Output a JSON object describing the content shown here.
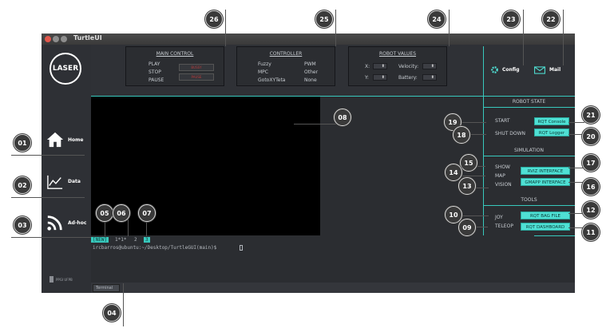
{
  "app": {
    "title": "TurtleUI"
  },
  "logo": {
    "text": "LASER"
  },
  "sidebar": {
    "items": [
      {
        "label": "Home",
        "icon": "home-icon"
      },
      {
        "label": "Data",
        "icon": "chart-icon"
      },
      {
        "label": "Ad-hoc",
        "icon": "wifi-icon"
      }
    ],
    "footer": "PPGI UFPB"
  },
  "main_control": {
    "title": "MAIN CONTROL",
    "play": "PLAY",
    "stop": "STOP",
    "pause": "PAUSE",
    "status_1": "BUSSY",
    "status_2": "PAUSE"
  },
  "controller": {
    "title": "CONTROLLER",
    "options": [
      "Fuzzy",
      "PWM",
      "MPC",
      "Other",
      "GotoXYTeta",
      "None"
    ]
  },
  "robot_values": {
    "title": "ROBOT VALUES",
    "x_label": "X:",
    "y_label": "Y:",
    "velocity_label": "Velocity:",
    "battery_label": "Battery:"
  },
  "top_right": {
    "config_label": "Config",
    "mail_label": "Mail"
  },
  "robot_state": {
    "title": "ROBOT STATE",
    "start": "START",
    "shutdown": "SHUT DOWN",
    "rqt_console": "RQT Console",
    "rqt_logger": "RQT Logger"
  },
  "simulation": {
    "title": "SIMULATION",
    "show": "SHOW",
    "map": "MAP",
    "vision": "VISION",
    "rviz": "RVIZ INTERFACE",
    "gmapp": "GMAPP INTERFACE"
  },
  "tools": {
    "title": "TOOLS",
    "joy": "JOY",
    "teleop": "TELEOP",
    "rqt_bag": "RQT BAG FILE",
    "rqt_dashboard": "RQT DASHBOARD"
  },
  "terminal": {
    "tabs": [
      "[NEW]",
      "1*1*",
      "2",
      "3"
    ],
    "prompt": "ircbarros@ubuntu:~/Desktop/TurtleGUI(main)$",
    "tab_label": "Terminal"
  },
  "callouts": [
    "01",
    "02",
    "03",
    "04",
    "05",
    "06",
    "07",
    "08",
    "09",
    "10",
    "11",
    "12",
    "13",
    "14",
    "15",
    "16",
    "17",
    "18",
    "19",
    "20",
    "21",
    "22",
    "23",
    "24",
    "25",
    "26"
  ],
  "colors": {
    "accent": "#4fe0d4",
    "background": "#2b2d31",
    "canvas": "#000000"
  }
}
